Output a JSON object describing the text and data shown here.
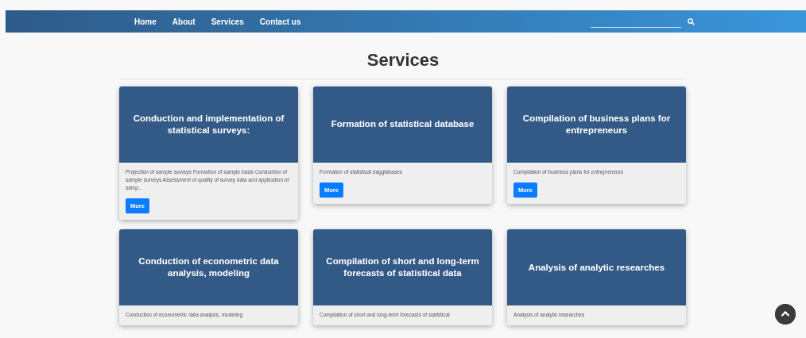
{
  "nav": {
    "links": [
      {
        "label": "Home"
      },
      {
        "label": "About"
      },
      {
        "label": "Services"
      },
      {
        "label": "Contact us"
      }
    ]
  },
  "page_title": "Services",
  "cards": [
    {
      "title": "Conduction and implementation of statistical surveys:",
      "text": "Projection of sample surveys Formation of sample basis Conduction of sample surveys Assessment of quality of survey data and application of samp...",
      "button": "More"
    },
    {
      "title": "Formation of statistical database",
      "text": "Formation of statistical daggtabases",
      "button": "More"
    },
    {
      "title": "Compilation of business plans for entrepreneurs",
      "text": "Compilation of business plans for entrepreneurs",
      "button": "More"
    },
    {
      "title": "Conduction of econometric data analysis, modeling",
      "text": "Conduction of econometric data analysis, modeling"
    },
    {
      "title": "Compilation of short and long-term forecasts of statistical data",
      "text": "Compilation of short and long-term forecasts of statistical"
    },
    {
      "title": "Analysis of analytic researches",
      "text": "Analysis of analytic researches"
    }
  ]
}
